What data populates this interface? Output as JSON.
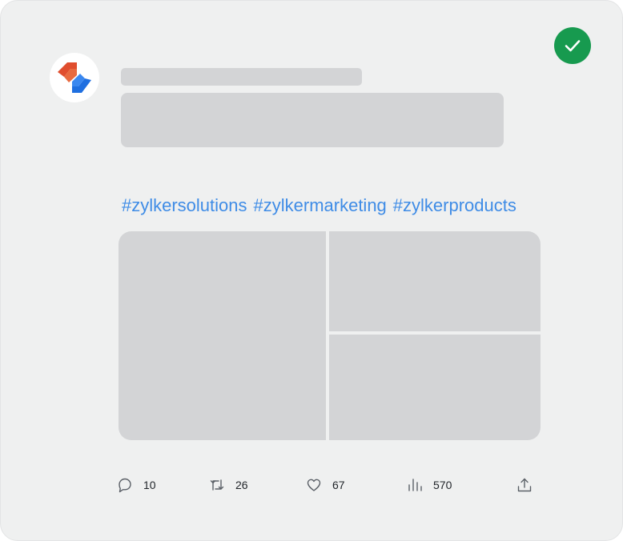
{
  "post": {
    "verified_icon": "check-circle-icon",
    "avatar_icon": "zylker-logo-icon",
    "hashtags": [
      "#zylkersolutions",
      "#zylkermarketing",
      "#zylkerproducts"
    ],
    "colors": {
      "card_background": "#eff0f0",
      "skeleton": "#d3d4d6",
      "hashtag": "#3f8ce6",
      "verified": "#179a4f",
      "logo_red": "#e04e2e",
      "logo_blue": "#1f6fe0"
    }
  },
  "actions": {
    "reply": {
      "icon": "comment-icon",
      "count": "10"
    },
    "repost": {
      "icon": "repost-icon",
      "count": "26"
    },
    "like": {
      "icon": "heart-icon",
      "count": "67"
    },
    "views": {
      "icon": "views-icon",
      "count": "570"
    },
    "share": {
      "icon": "share-icon"
    }
  }
}
